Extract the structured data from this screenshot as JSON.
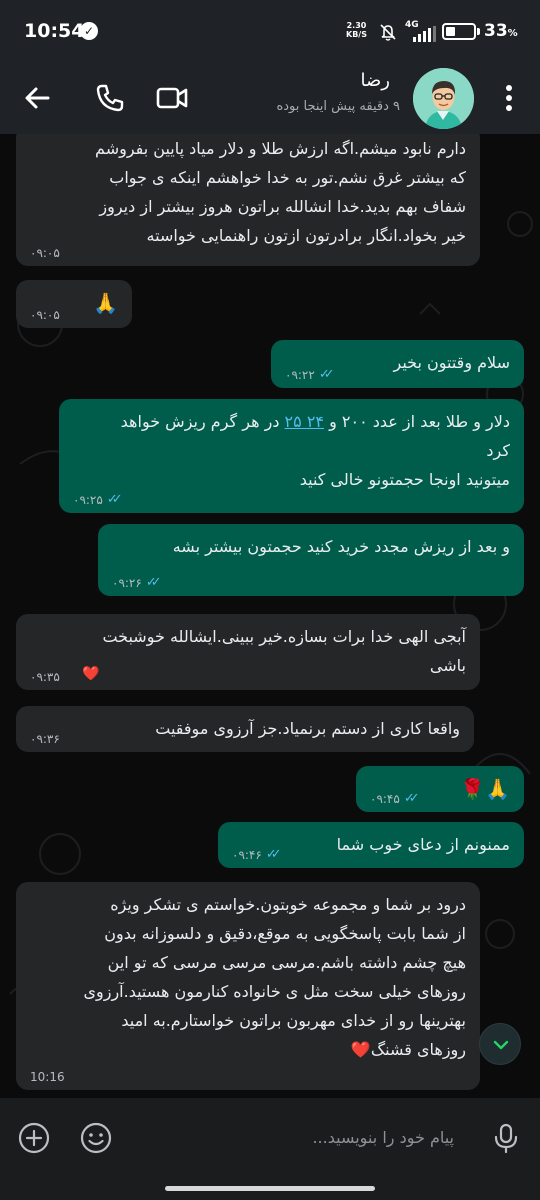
{
  "status_bar": {
    "time": "10:54",
    "speed_value": "2.30",
    "speed_unit": "KB/S",
    "network": "4G",
    "battery": "33",
    "battery_unit": "%",
    "battery_level": 0.33
  },
  "header": {
    "contact_name": "رضا",
    "last_seen": "۹ دقیقه پیش اینجا بوده",
    "icons": [
      "back-arrow-icon",
      "phone-icon",
      "video-camera-icon",
      "more-vert-icon"
    ]
  },
  "messages": [
    {
      "dir": "in",
      "lines": [
        "دارم نابود میشم.اگه ارزش طلا و دلار میاد پایین بفروشم",
        "که بیشتر غرق نشم.تور به خدا خواهشم اینکه ی جواب",
        "شفاف بهم بدید.خدا انشالله براتون هروز بیشتر از دیروز",
        "خیر بخواد.انگار برادرتون ازتون راهنمایی خواسته"
      ],
      "time": "۰۹:۰۵"
    },
    {
      "dir": "in",
      "text": "🙏",
      "time": "۰۹:۰۵"
    },
    {
      "dir": "out",
      "text": "سلام وقتتون بخیر",
      "time": "۰۹:۲۲"
    },
    {
      "dir": "out",
      "before": "دلار و طلا بعد از عدد ۲۰۰ و ",
      "link": "۲۴ ۲۵",
      "after": " در هر گرم ریزش خواهد",
      "line2": "کرد",
      "line3": "میتونید اونجا حجمتونو خالی کنید",
      "time": "۰۹:۲۵"
    },
    {
      "dir": "out",
      "text": "و بعد از ریزش مجدد خرید کنید حجمتون بیشتر بشه",
      "time": "۰۹:۲۶"
    },
    {
      "dir": "in",
      "lines": [
        "آبجی الهی خدا برات بسازه.خیر ببینی.ایشالله خوشبخت",
        "باشی"
      ],
      "time": "۰۹:۳۵",
      "reaction": "❤️"
    },
    {
      "dir": "in",
      "text": "واقعا کاری از دستم برنمیاد.جز آرزوی موفقیت",
      "time": "۰۹:۳۶"
    },
    {
      "dir": "out",
      "text": "🙏🌹",
      "time": "۰۹:۴۵"
    },
    {
      "dir": "out",
      "text": "ممنونم از دعای خوب شما",
      "time": "۰۹:۴۶"
    },
    {
      "dir": "in",
      "lines": [
        "درود بر شما و مجموعه خوبتون.خواستم ی تشکر ویژه",
        "از شما بابت پاسخگویی به موقع،دقیق و دلسوزانه بدون",
        "هیچ چشم داشته باشم.مرسی مرسی مرسی که تو این",
        "روزهای خیلی سخت مثل ی خانواده کنارمون هستید.آرزوی",
        "بهترینها رو از خدای مهربون براتون خواستارم.به امید",
        "روزهای قشنگ❤️"
      ],
      "time": "10:16"
    }
  ],
  "input": {
    "placeholder": "پیام خود را بنویسید...",
    "icons": [
      "add-circle-icon",
      "emoji-icon",
      "microphone-icon"
    ]
  },
  "colors": {
    "header_bg": "#1f2226",
    "incoming_bubble": "#242628",
    "outgoing_bubble": "#005c4b",
    "read_ticks": "#53bdeb",
    "link": "#53bdeb"
  }
}
